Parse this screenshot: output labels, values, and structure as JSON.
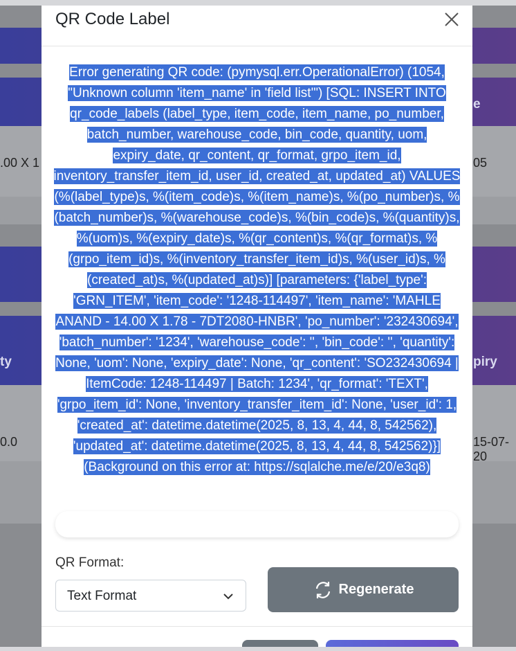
{
  "modal": {
    "title": "QR Code Label",
    "error_message": "Error generating QR code: (pymysql.err.OperationalError) (1054, \"Unknown column 'item_name' in 'field list'\") [SQL: INSERT INTO qr_code_labels (label_type, item_code, item_name, po_number, batch_number, warehouse_code, bin_code, quantity, uom, expiry_date, qr_content, qr_format, grpo_item_id, inventory_transfer_item_id, user_id, created_at, updated_at) VALUES (%(label_type)s, %(item_code)s, %(item_name)s, %(po_number)s, %(batch_number)s, %(warehouse_code)s, %(bin_code)s, %(quantity)s, %(uom)s, %(expiry_date)s, %(qr_content)s, %(qr_format)s, %(grpo_item_id)s, %(inventory_transfer_item_id)s, %(user_id)s, %(created_at)s, %(updated_at)s)] [parameters: {'label_type': 'GRN_ITEM', 'item_code': '1248-114497', 'item_name': 'MAHLE ANAND - 14.00 X 1.78 - 7DT2080-HNBR', 'po_number': '232430694', 'batch_number': '1234', 'warehouse_code': '', 'bin_code': '', 'quantity': None, 'uom': None, 'expiry_date': None, 'qr_content': 'SO232430694 | ItemCode: 1248-114497 | Batch: 1234', 'qr_format': 'TEXT', 'grpo_item_id': None, 'inventory_transfer_item_id': None, 'user_id': 1, 'created_at': datetime.datetime(2025, 8, 13, 4, 44, 8, 542562), 'updated_at': datetime.datetime(2025, 8, 13, 4, 44, 8, 542562)}] (Background on this error at: https://sqlalche.me/e/20/e3q8)",
    "qr_format_label": "QR Format:",
    "qr_format_selected": "Text Format",
    "regenerate_label": "Regenerate"
  },
  "background": {
    "cell_left_1": ".00 X 1",
    "cell_right_1": "05",
    "header_right_1": "e",
    "header_left_2": "ty",
    "header_right_2": "piry",
    "cell_left_2": "0.0",
    "cell_right_2": "15-07-20"
  },
  "colors": {
    "selection": "#3c6fd6",
    "button_secondary": "#6c757d",
    "header_band": "#3a3e9a"
  },
  "icons": {
    "close": "close-icon",
    "chevron": "chevron-down-icon",
    "regenerate": "refresh-icon"
  }
}
